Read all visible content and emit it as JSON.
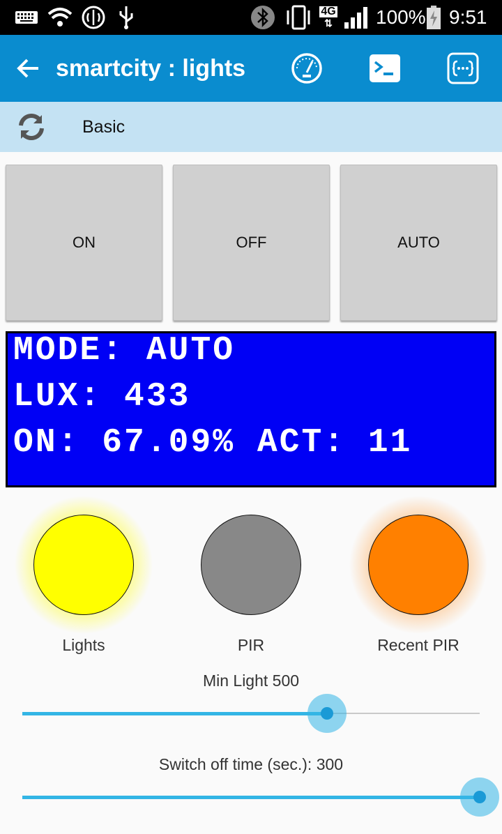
{
  "status_bar": {
    "network": "4G",
    "battery": "100%",
    "time": "9:51",
    "icons": [
      "keyboard-icon",
      "wifi-icon",
      "brain-icon",
      "usb-icon",
      "bluetooth-icon",
      "vibrate-icon",
      "signal-icon",
      "battery-charging-icon"
    ]
  },
  "app_bar": {
    "title": "smartcity : lights",
    "icons": [
      "back-arrow-icon",
      "dashboard-gauge-icon",
      "terminal-icon",
      "code-braces-icon"
    ]
  },
  "tab_bar": {
    "label": "Basic",
    "icon": "refresh-icon"
  },
  "buttons": [
    "ON",
    "OFF",
    "AUTO"
  ],
  "lcd": {
    "line1": "MODE: AUTO",
    "line2": "LUX: 433",
    "line3": "ON: 67.09% ACT: 11",
    "bg_color": "#0000f5",
    "text_color": "#ffffff"
  },
  "leds": [
    {
      "label": "Lights",
      "color": "#ffff00",
      "lit": true
    },
    {
      "label": "PIR",
      "color": "#888888",
      "lit": false
    },
    {
      "label": "Recent PIR",
      "color": "#ff8000",
      "lit": true
    }
  ],
  "sliders": [
    {
      "label": "Min Light 500",
      "fraction": 0.666
    },
    {
      "label": "Switch off time (sec.): 300",
      "fraction": 1.0
    }
  ],
  "colors": {
    "app_bar": "#0a8ccf",
    "tab_bar": "#c4e2f3",
    "slider_accent": "#33b5e5"
  }
}
